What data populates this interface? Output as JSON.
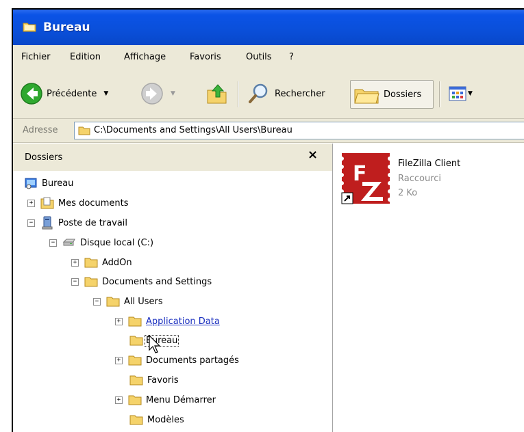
{
  "window": {
    "title": "Bureau"
  },
  "menu": [
    "Fichier",
    "Edition",
    "Affichage",
    "Favoris",
    "Outils",
    "?"
  ],
  "toolbar": {
    "back_label": "Précédente",
    "search_label": "Rechercher",
    "folders_label": "Dossiers"
  },
  "address": {
    "label": "Adresse",
    "value": "C:\\Documents and Settings\\All Users\\Bureau"
  },
  "folders_pane": {
    "title": "Dossiers",
    "close": "×",
    "tree": [
      {
        "label": "Bureau",
        "icon": "desktop-icon"
      },
      {
        "label": "Mes documents",
        "icon": "documents-folder-icon",
        "expander": "+"
      },
      {
        "label": "Poste de travail",
        "icon": "computer-icon",
        "expander": "−"
      },
      {
        "label": "Disque local (C:)",
        "icon": "drive-icon",
        "expander": "−"
      },
      {
        "label": "AddOn",
        "icon": "folder-icon",
        "expander": "+"
      },
      {
        "label": "Documents and Settings",
        "icon": "folder-icon",
        "expander": "−"
      },
      {
        "label": "All Users",
        "icon": "folder-icon",
        "expander": "−"
      },
      {
        "label": "Application Data",
        "icon": "folder-icon",
        "expander": "+",
        "link": true
      },
      {
        "label": "Bureau",
        "icon": "folder-icon",
        "selected": true
      },
      {
        "label": "Documents partagés",
        "icon": "folder-icon",
        "expander": "+"
      },
      {
        "label": "Favoris",
        "icon": "folder-icon"
      },
      {
        "label": "Menu Démarrer",
        "icon": "folder-icon",
        "expander": "+"
      },
      {
        "label": "Modèles",
        "icon": "folder-icon"
      }
    ]
  },
  "files": [
    {
      "name": "FileZilla Client",
      "type": "Raccourci",
      "size": "2 Ko",
      "icon": "filezilla-icon"
    }
  ],
  "colors": {
    "titlebar": "#0a4fd9",
    "chrome": "#ece9d8",
    "folder": "#f5d36b",
    "link": "#1a2fbf",
    "filezilla_red": "#bf1e1e"
  }
}
